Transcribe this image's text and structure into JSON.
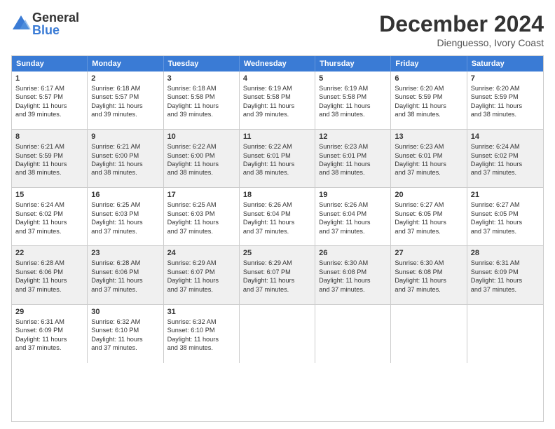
{
  "logo": {
    "general": "General",
    "blue": "Blue"
  },
  "title": {
    "month": "December 2024",
    "location": "Dienguesso, Ivory Coast"
  },
  "header_days": [
    "Sunday",
    "Monday",
    "Tuesday",
    "Wednesday",
    "Thursday",
    "Friday",
    "Saturday"
  ],
  "weeks": [
    [
      {
        "day": "1",
        "sunrise": "6:17 AM",
        "sunset": "5:57 PM",
        "daylight": "11 hours and 39 minutes.",
        "shaded": false
      },
      {
        "day": "2",
        "sunrise": "6:18 AM",
        "sunset": "5:57 PM",
        "daylight": "11 hours and 39 minutes.",
        "shaded": false
      },
      {
        "day": "3",
        "sunrise": "6:18 AM",
        "sunset": "5:58 PM",
        "daylight": "11 hours and 39 minutes.",
        "shaded": false
      },
      {
        "day": "4",
        "sunrise": "6:19 AM",
        "sunset": "5:58 PM",
        "daylight": "11 hours and 39 minutes.",
        "shaded": false
      },
      {
        "day": "5",
        "sunrise": "6:19 AM",
        "sunset": "5:58 PM",
        "daylight": "11 hours and 38 minutes.",
        "shaded": false
      },
      {
        "day": "6",
        "sunrise": "6:20 AM",
        "sunset": "5:59 PM",
        "daylight": "11 hours and 38 minutes.",
        "shaded": false
      },
      {
        "day": "7",
        "sunrise": "6:20 AM",
        "sunset": "5:59 PM",
        "daylight": "11 hours and 38 minutes.",
        "shaded": false
      }
    ],
    [
      {
        "day": "8",
        "sunrise": "6:21 AM",
        "sunset": "5:59 PM",
        "daylight": "11 hours and 38 minutes.",
        "shaded": true
      },
      {
        "day": "9",
        "sunrise": "6:21 AM",
        "sunset": "6:00 PM",
        "daylight": "11 hours and 38 minutes.",
        "shaded": true
      },
      {
        "day": "10",
        "sunrise": "6:22 AM",
        "sunset": "6:00 PM",
        "daylight": "11 hours and 38 minutes.",
        "shaded": true
      },
      {
        "day": "11",
        "sunrise": "6:22 AM",
        "sunset": "6:01 PM",
        "daylight": "11 hours and 38 minutes.",
        "shaded": true
      },
      {
        "day": "12",
        "sunrise": "6:23 AM",
        "sunset": "6:01 PM",
        "daylight": "11 hours and 38 minutes.",
        "shaded": true
      },
      {
        "day": "13",
        "sunrise": "6:23 AM",
        "sunset": "6:01 PM",
        "daylight": "11 hours and 37 minutes.",
        "shaded": true
      },
      {
        "day": "14",
        "sunrise": "6:24 AM",
        "sunset": "6:02 PM",
        "daylight": "11 hours and 37 minutes.",
        "shaded": true
      }
    ],
    [
      {
        "day": "15",
        "sunrise": "6:24 AM",
        "sunset": "6:02 PM",
        "daylight": "11 hours and 37 minutes.",
        "shaded": false
      },
      {
        "day": "16",
        "sunrise": "6:25 AM",
        "sunset": "6:03 PM",
        "daylight": "11 hours and 37 minutes.",
        "shaded": false
      },
      {
        "day": "17",
        "sunrise": "6:25 AM",
        "sunset": "6:03 PM",
        "daylight": "11 hours and 37 minutes.",
        "shaded": false
      },
      {
        "day": "18",
        "sunrise": "6:26 AM",
        "sunset": "6:04 PM",
        "daylight": "11 hours and 37 minutes.",
        "shaded": false
      },
      {
        "day": "19",
        "sunrise": "6:26 AM",
        "sunset": "6:04 PM",
        "daylight": "11 hours and 37 minutes.",
        "shaded": false
      },
      {
        "day": "20",
        "sunrise": "6:27 AM",
        "sunset": "6:05 PM",
        "daylight": "11 hours and 37 minutes.",
        "shaded": false
      },
      {
        "day": "21",
        "sunrise": "6:27 AM",
        "sunset": "6:05 PM",
        "daylight": "11 hours and 37 minutes.",
        "shaded": false
      }
    ],
    [
      {
        "day": "22",
        "sunrise": "6:28 AM",
        "sunset": "6:06 PM",
        "daylight": "11 hours and 37 minutes.",
        "shaded": true
      },
      {
        "day": "23",
        "sunrise": "6:28 AM",
        "sunset": "6:06 PM",
        "daylight": "11 hours and 37 minutes.",
        "shaded": true
      },
      {
        "day": "24",
        "sunrise": "6:29 AM",
        "sunset": "6:07 PM",
        "daylight": "11 hours and 37 minutes.",
        "shaded": true
      },
      {
        "day": "25",
        "sunrise": "6:29 AM",
        "sunset": "6:07 PM",
        "daylight": "11 hours and 37 minutes.",
        "shaded": true
      },
      {
        "day": "26",
        "sunrise": "6:30 AM",
        "sunset": "6:08 PM",
        "daylight": "11 hours and 37 minutes.",
        "shaded": true
      },
      {
        "day": "27",
        "sunrise": "6:30 AM",
        "sunset": "6:08 PM",
        "daylight": "11 hours and 37 minutes.",
        "shaded": true
      },
      {
        "day": "28",
        "sunrise": "6:31 AM",
        "sunset": "6:09 PM",
        "daylight": "11 hours and 37 minutes.",
        "shaded": true
      }
    ],
    [
      {
        "day": "29",
        "sunrise": "6:31 AM",
        "sunset": "6:09 PM",
        "daylight": "11 hours and 37 minutes.",
        "shaded": false
      },
      {
        "day": "30",
        "sunrise": "6:32 AM",
        "sunset": "6:10 PM",
        "daylight": "11 hours and 37 minutes.",
        "shaded": false
      },
      {
        "day": "31",
        "sunrise": "6:32 AM",
        "sunset": "6:10 PM",
        "daylight": "11 hours and 38 minutes.",
        "shaded": false
      },
      {
        "day": "",
        "sunrise": "",
        "sunset": "",
        "daylight": "",
        "shaded": false
      },
      {
        "day": "",
        "sunrise": "",
        "sunset": "",
        "daylight": "",
        "shaded": false
      },
      {
        "day": "",
        "sunrise": "",
        "sunset": "",
        "daylight": "",
        "shaded": false
      },
      {
        "day": "",
        "sunrise": "",
        "sunset": "",
        "daylight": "",
        "shaded": false
      }
    ]
  ]
}
